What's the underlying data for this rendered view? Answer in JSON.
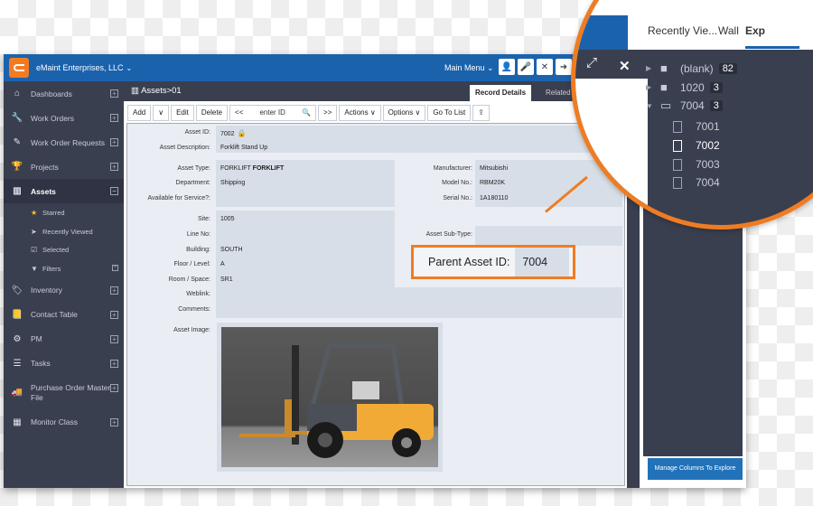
{
  "topbar": {
    "org_name": "eMaint Enterprises, LLC",
    "main_menu": "Main Menu",
    "icons": [
      "user-icon",
      "microphone-icon",
      "tools-icon",
      "logout-icon"
    ]
  },
  "sidebar": {
    "items": [
      {
        "label": "Dashboards",
        "icon": "home-icon"
      },
      {
        "label": "Work Orders",
        "icon": "wrench-icon"
      },
      {
        "label": "Work Order Requests",
        "icon": "pencil-icon"
      },
      {
        "label": "Projects",
        "icon": "trophy-icon"
      },
      {
        "label": "Assets",
        "icon": "barcode-icon"
      },
      {
        "label": "Inventory",
        "icon": "tag-icon"
      },
      {
        "label": "Contact Table",
        "icon": "book-icon"
      },
      {
        "label": "PM",
        "icon": "gears-icon"
      },
      {
        "label": "Tasks",
        "icon": "tasks-icon"
      },
      {
        "label": "Purchase Order Master File",
        "icon": "truck-icon"
      },
      {
        "label": "Monitor Class",
        "icon": "grid-icon"
      }
    ],
    "asset_sub": [
      {
        "label": "Starred",
        "icon": "star-icon"
      },
      {
        "label": "Recently Viewed",
        "icon": "arrow-icon"
      },
      {
        "label": "Selected",
        "icon": "checkbox-icon"
      },
      {
        "label": "Filters",
        "icon": "filter-icon"
      }
    ]
  },
  "content": {
    "breadcrumb": "Assets>01",
    "tabs": [
      "Record Details",
      "Related T"
    ]
  },
  "toolbar": {
    "add": "Add",
    "dropdown": "∨",
    "edit": "Edit",
    "delete": "Delete",
    "prev": "<<",
    "search_placeholder": "enter ID",
    "next": ">>",
    "actions": "Actions ∨",
    "options": "Options ∨",
    "go_to_list": "Go To List"
  },
  "form": {
    "asset_id_label": "Asset ID:",
    "asset_id": "7002",
    "desc_label": "Asset Description:",
    "desc": "Forklift Stand Up",
    "type_label": "Asset Type:",
    "type_plain": "FORKLIFT",
    "type_bold": "FORKLIFT",
    "dept_label": "Department:",
    "dept": "Shipping",
    "avail_label": "Available for Service?:",
    "site_label": "Site:",
    "site": "1005",
    "line_label": "Line No:",
    "building_label": "Building:",
    "building": "SOUTH",
    "floor_label": "Floor / Level:",
    "floor": "A",
    "room_label": "Room / Space:",
    "room": "SR1",
    "weblink_label": "Weblink:",
    "comments_label": "Comments:",
    "image_label": "Asset Image:",
    "mfr_label": "Manufacturer:",
    "mfr": "Mitsubishi",
    "model_label": "Model No.:",
    "model": "RBM20K",
    "serial_label": "Serial No.:",
    "serial": "1A180110",
    "subtype_label": "Asset Sub-Type:"
  },
  "callout": {
    "parent_label": "Parent Asset ID:",
    "parent_value": "7004"
  },
  "explore": {
    "tabs": [
      "Recently Vie...",
      "Wall",
      "Exp"
    ],
    "tree": [
      {
        "label": "(blank)",
        "count": "82"
      },
      {
        "label": "1020",
        "count": "3"
      },
      {
        "label": "7004",
        "count": "3"
      }
    ],
    "files": [
      "7001",
      "7002",
      "7003",
      "7004"
    ],
    "selected": "7002",
    "manage_button": "Manage Columns To Explore"
  }
}
